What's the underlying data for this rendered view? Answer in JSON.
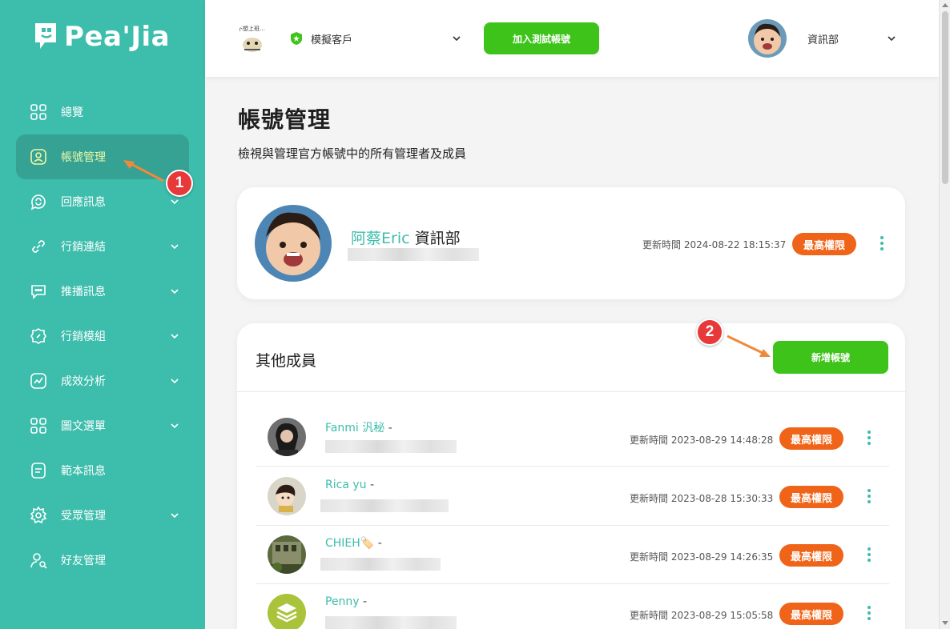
{
  "app": {
    "logo_text": "Pea'Jia"
  },
  "sidebar": {
    "items": [
      {
        "label": "總覽",
        "icon": "grid-icon",
        "expandable": false
      },
      {
        "label": "帳號管理",
        "icon": "user-square-icon",
        "expandable": false,
        "active": true
      },
      {
        "label": "回應訊息",
        "icon": "reply-chat-icon",
        "expandable": true
      },
      {
        "label": "行銷連結",
        "icon": "link-icon",
        "expandable": true
      },
      {
        "label": "推播訊息",
        "icon": "chat-bubble-icon",
        "expandable": true
      },
      {
        "label": "行銷模組",
        "icon": "compass-icon",
        "expandable": true
      },
      {
        "label": "成效分析",
        "icon": "chart-icon",
        "expandable": true
      },
      {
        "label": "圖文選單",
        "icon": "layout-icon",
        "expandable": true
      },
      {
        "label": "範本訊息",
        "icon": "template-icon",
        "expandable": false
      },
      {
        "label": "受眾管理",
        "icon": "gear-icon",
        "expandable": true
      },
      {
        "label": "好友管理",
        "icon": "user-search-icon",
        "expandable": false
      }
    ]
  },
  "header": {
    "client_name": "模擬客戶",
    "join_button": "加入測試帳號",
    "user_name": "資訊部"
  },
  "page": {
    "title": "帳號管理",
    "subtitle": "檢視與管理官方帳號中的所有管理者及成員"
  },
  "owner": {
    "name": "阿蔡Eric",
    "dept": "資訊部",
    "update_time": "更新時間 2024-08-22 18:15:37",
    "permission": "最高權限"
  },
  "members_section": {
    "title": "其他成員",
    "add_button": "新增帳號",
    "members": [
      {
        "name": "Fanmi 汎秘",
        "dash": "-",
        "update_time": "更新時間 2023-08-29 14:48:28",
        "permission": "最高權限"
      },
      {
        "name": "Rica yu",
        "dash": "-",
        "update_time": "更新時間 2023-08-28 15:30:33",
        "permission": "最高權限"
      },
      {
        "name": "CHIEH🏷️",
        "dash": "-",
        "update_time": "更新時間 2023-08-29 14:26:35",
        "permission": "最高權限"
      },
      {
        "name": "Penny",
        "dash": "-",
        "update_time": "更新時間 2023-08-29 15:05:58",
        "permission": "最高權限"
      }
    ]
  },
  "annotations": {
    "step1": "1",
    "step2": "2"
  },
  "colors": {
    "sidebar": "#3dbdac",
    "accent_green": "#3ec31b",
    "badge_orange": "#ef6418",
    "annotation_red": "#e7393a"
  }
}
